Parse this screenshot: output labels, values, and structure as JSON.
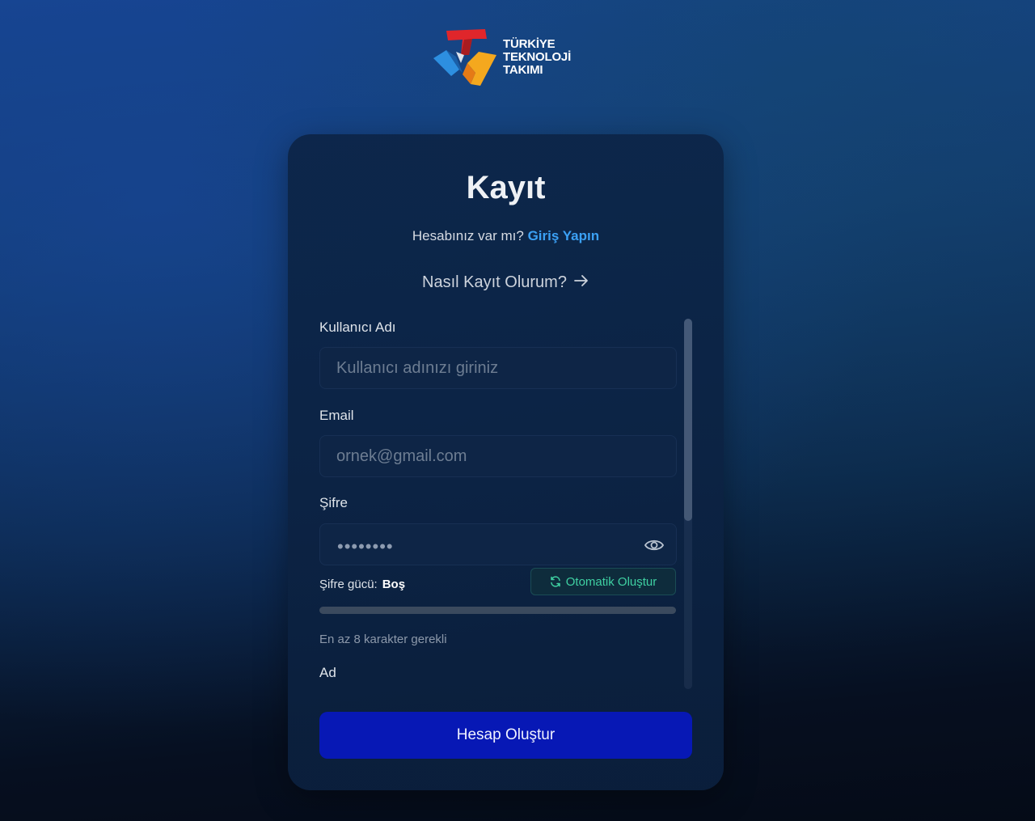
{
  "logo": {
    "line1": "TÜRKİYE",
    "line2": "TEKNOLOJİ",
    "line3": "TAKIMI"
  },
  "form": {
    "title": "Kayıt",
    "have_account_text": "Hesabınız var mı?",
    "login_link": "Giriş Yapın",
    "howto_link": "Nasıl Kayıt Olurum?",
    "username": {
      "label": "Kullanıcı Adı",
      "placeholder": "Kullanıcı adınızı giriniz",
      "value": ""
    },
    "email": {
      "label": "Email",
      "placeholder": "ornek@gmail.com",
      "value": ""
    },
    "password": {
      "label": "Şifre",
      "placeholder": "••••••••",
      "value": ""
    },
    "strength": {
      "label": "Şifre gücü:",
      "value": "Boş",
      "level_percent": 0
    },
    "auto_generate_label": "Otomatik Oluştur",
    "hint": "En az 8 karakter gerekli",
    "first_name": {
      "label": "Ad"
    },
    "submit_label": "Hesap Oluştur"
  },
  "colors": {
    "accent_link": "#3ba1f5",
    "submit_bg": "#0718b5",
    "auto_btn_text": "#3fd0a2"
  },
  "icons": {
    "arrow": "arrow-right-icon",
    "eye": "eye-icon",
    "refresh": "refresh-icon"
  }
}
